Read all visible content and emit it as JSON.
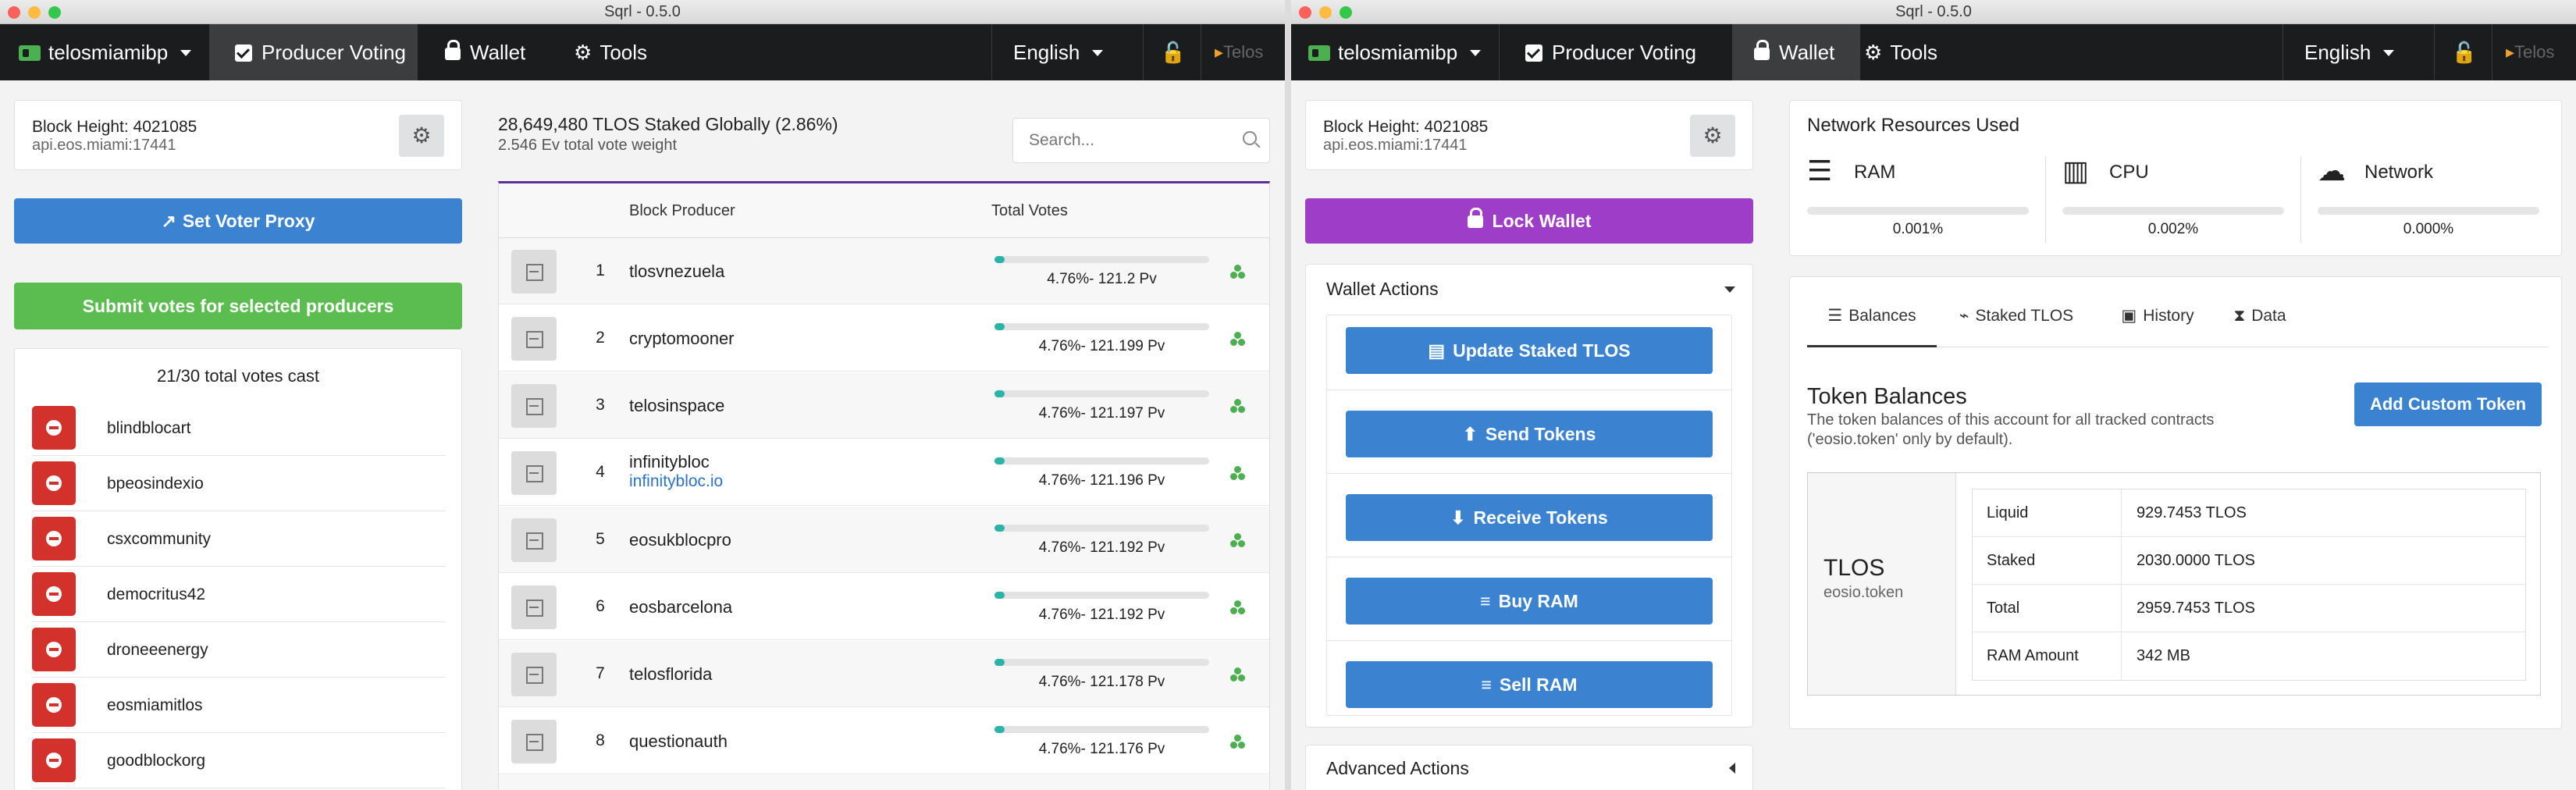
{
  "left": {
    "window_title": "Sqrl - 0.5.0",
    "menu": {
      "account": "telosmiamibp",
      "producer_voting": "Producer Voting",
      "wallet": "Wallet",
      "tools": "Tools",
      "language": "English",
      "chain": "Telos"
    },
    "status": {
      "block_height": "Block Height: 4021085",
      "node": "api.eos.miami:17441"
    },
    "buttons": {
      "set_proxy": "Set Voter Proxy",
      "submit_votes": "Submit votes for selected producers"
    },
    "votes_cast": "21/30 total votes cast",
    "selected_producers": [
      "blindblocart",
      "bpeosindexio",
      "csxcommunity",
      "democritus42",
      "droneeenergy",
      "eosmiamitlos",
      "goodblockorg"
    ],
    "stake_summary": {
      "staked": "28,649,480 TLOS Staked Globally (2.86%)",
      "weight": "2.546 Ev total vote weight"
    },
    "search": {
      "placeholder": "Search..."
    },
    "table": {
      "col_producer": "Block Producer",
      "col_votes": "Total Votes",
      "rows": [
        {
          "rank": "1",
          "name": "tlosvnezuela",
          "link": "",
          "votes": "4.76%- 121.2 Pv",
          "pct": 0.0476
        },
        {
          "rank": "2",
          "name": "cryptomooner",
          "link": "",
          "votes": "4.76%- 121.199 Pv",
          "pct": 0.0476
        },
        {
          "rank": "3",
          "name": "telosinspace",
          "link": "",
          "votes": "4.76%- 121.197 Pv",
          "pct": 0.0476
        },
        {
          "rank": "4",
          "name": "infinitybloc",
          "link": "infinitybloc.io",
          "votes": "4.76%- 121.196 Pv",
          "pct": 0.0476
        },
        {
          "rank": "5",
          "name": "eosukblocpro",
          "link": "",
          "votes": "4.76%- 121.192 Pv",
          "pct": 0.0476
        },
        {
          "rank": "6",
          "name": "eosbarcelona",
          "link": "",
          "votes": "4.76%- 121.192 Pv",
          "pct": 0.0476
        },
        {
          "rank": "7",
          "name": "telosflorida",
          "link": "",
          "votes": "4.76%- 121.178 Pv",
          "pct": 0.0476
        },
        {
          "rank": "8",
          "name": "questionauth",
          "link": "",
          "votes": "4.76%- 121.176 Pv",
          "pct": 0.0476
        }
      ]
    }
  },
  "right": {
    "window_title": "Sqrl - 0.5.0",
    "menu": {
      "account": "telosmiamibp",
      "producer_voting": "Producer Voting",
      "wallet": "Wallet",
      "tools": "Tools",
      "language": "English",
      "chain": "Telos"
    },
    "status": {
      "block_height": "Block Height: 4021085",
      "node": "api.eos.miami:17441"
    },
    "lock_wallet": "Lock Wallet",
    "wallet_actions": {
      "title": "Wallet Actions",
      "items": [
        "Update Staked TLOS",
        "Send Tokens",
        "Receive Tokens",
        "Buy RAM",
        "Sell RAM"
      ]
    },
    "advanced_actions": "Advanced Actions",
    "resources": {
      "title": "Network Resources Used",
      "items": [
        {
          "name": "RAM",
          "value": "0.001%",
          "pct": 1e-05
        },
        {
          "name": "CPU",
          "value": "0.002%",
          "pct": 2e-05
        },
        {
          "name": "Network",
          "value": "0.000%",
          "pct": 0.0
        }
      ]
    },
    "tabs": [
      "Balances",
      "Staked TLOS",
      "History",
      "Data"
    ],
    "balances": {
      "title": "Token Balances",
      "description_1": "The token balances of this account for all tracked contracts",
      "description_2": "('eosio.token' only by default).",
      "add_button": "Add Custom Token",
      "token_symbol": "TLOS",
      "token_contract": "eosio.token",
      "rows": [
        {
          "label": "Liquid",
          "value": "929.7453 TLOS"
        },
        {
          "label": "Staked",
          "value": "2030.0000 TLOS"
        },
        {
          "label": "Total",
          "value": "2959.7453 TLOS"
        },
        {
          "label": "RAM Amount",
          "value": "342 MB"
        }
      ]
    }
  }
}
